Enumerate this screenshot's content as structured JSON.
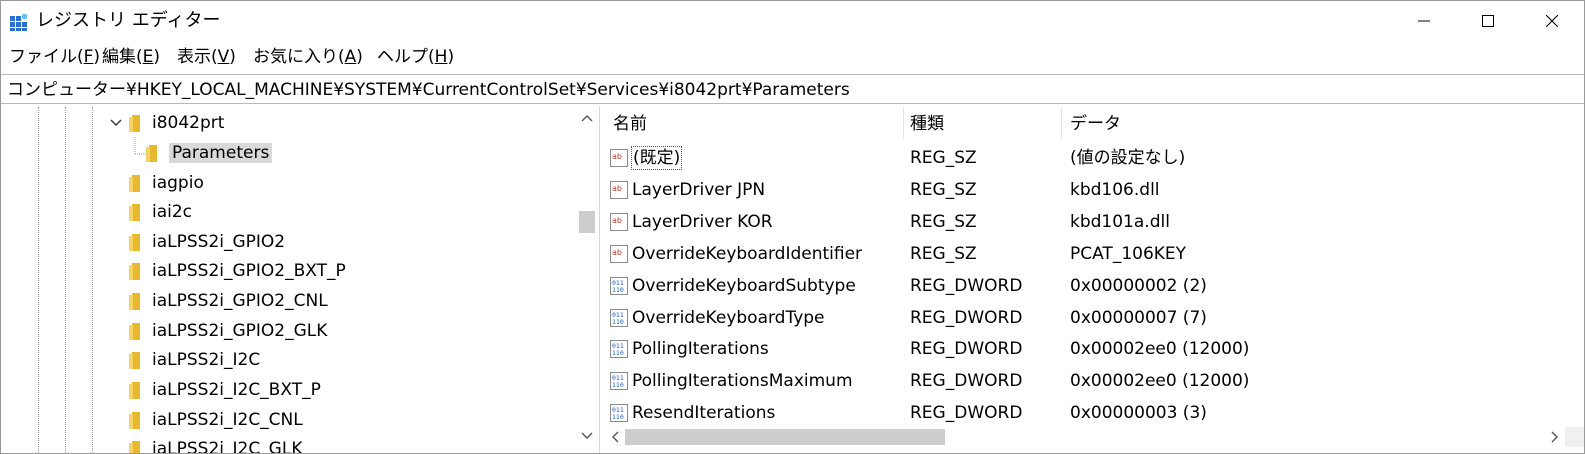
{
  "window": {
    "title": "レジストリ エディター",
    "icon": "registry-editor-icon"
  },
  "menu": [
    {
      "label": "ファイル(",
      "acc": "F",
      "close": ")"
    },
    {
      "label": "編集(",
      "acc": "E",
      "close": ")"
    },
    {
      "label": "表示(",
      "acc": "V",
      "close": ")"
    },
    {
      "label": "お気に入り(",
      "acc": "A",
      "close": ")"
    },
    {
      "label": "ヘルプ(",
      "acc": "H",
      "close": ")"
    }
  ],
  "address": "コンピューター¥HKEY_LOCAL_MACHINE¥SYSTEM¥CurrentControlSet¥Services¥i8042prt¥Parameters",
  "tree": {
    "expanded_key": "i8042prt",
    "selected_key": "Parameters",
    "siblings": [
      "iagpio",
      "iai2c",
      "iaLPSS2i_GPIO2",
      "iaLPSS2i_GPIO2_BXT_P",
      "iaLPSS2i_GPIO2_CNL",
      "iaLPSS2i_GPIO2_GLK",
      "iaLPSS2i_I2C",
      "iaLPSS2i_I2C_BXT_P",
      "iaLPSS2i_I2C_CNL",
      "iaLPSS2i_I2C_GLK"
    ]
  },
  "list": {
    "columns": {
      "name": "名前",
      "type": "種類",
      "data": "データ"
    },
    "rows": [
      {
        "name": "(既定)",
        "type": "REG_SZ",
        "data": "(値の設定なし)",
        "icon": "string-value-icon"
      },
      {
        "name": "LayerDriver JPN",
        "type": "REG_SZ",
        "data": "kbd106.dll",
        "icon": "string-value-icon"
      },
      {
        "name": "LayerDriver KOR",
        "type": "REG_SZ",
        "data": "kbd101a.dll",
        "icon": "string-value-icon"
      },
      {
        "name": "OverrideKeyboardIdentifier",
        "type": "REG_SZ",
        "data": "PCAT_106KEY",
        "icon": "string-value-icon"
      },
      {
        "name": "OverrideKeyboardSubtype",
        "type": "REG_DWORD",
        "data": "0x00000002 (2)",
        "icon": "binary-value-icon"
      },
      {
        "name": "OverrideKeyboardType",
        "type": "REG_DWORD",
        "data": "0x00000007 (7)",
        "icon": "binary-value-icon"
      },
      {
        "name": "PollingIterations",
        "type": "REG_DWORD",
        "data": "0x00002ee0 (12000)",
        "icon": "binary-value-icon"
      },
      {
        "name": "PollingIterationsMaximum",
        "type": "REG_DWORD",
        "data": "0x00002ee0 (12000)",
        "icon": "binary-value-icon"
      },
      {
        "name": "ResendIterations",
        "type": "REG_DWORD",
        "data": "0x00000003 (3)",
        "icon": "binary-value-icon"
      }
    ]
  },
  "colors": {
    "folder": "#e8b92e",
    "selection": "#d9d9d9",
    "string_icon_red": "#c0392b",
    "binary_icon_blue": "#1f5fbf",
    "scroll_thumb": "#cdcdcd"
  }
}
